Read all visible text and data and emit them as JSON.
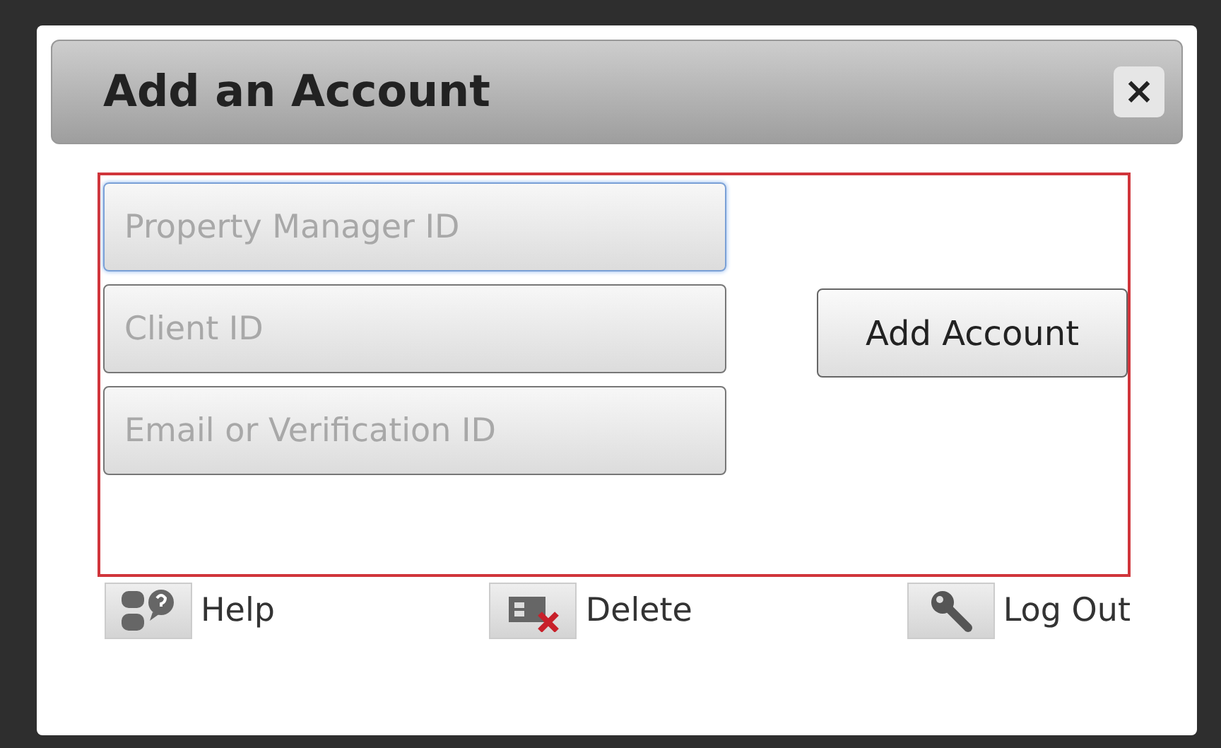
{
  "dialog": {
    "title": "Add an Account",
    "close": "×"
  },
  "fields": [
    {
      "placeholder": "Property Manager ID",
      "focused": true
    },
    {
      "placeholder": "Client ID",
      "focused": false
    },
    {
      "placeholder": "Email or Verification ID",
      "focused": false
    }
  ],
  "submit": "Add Account",
  "footer": [
    {
      "kind": "help",
      "label": "Help"
    },
    {
      "kind": "delete",
      "label": "Delete"
    },
    {
      "kind": "logout",
      "label": "Log Out"
    }
  ]
}
